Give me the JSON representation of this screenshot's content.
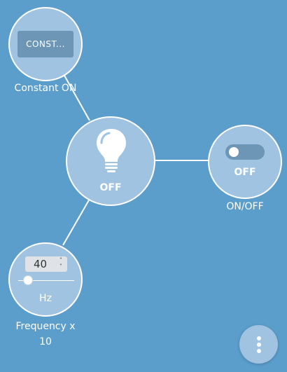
{
  "nodes": {
    "constant": {
      "button_label": "CONST...",
      "label": "Constant ON"
    },
    "bulb": {
      "state": "OFF",
      "icon": "lightbulb-icon"
    },
    "switch": {
      "state": "OFF",
      "toggle_on": false,
      "label": "ON/OFF"
    },
    "frequency": {
      "value": "40",
      "slider_value": 40,
      "unit": "Hz",
      "label_line1": "Frequency x",
      "label_line2": "10"
    }
  },
  "menu": {
    "icon": "more-vertical-icon"
  },
  "colors": {
    "background": "#5b9dcb",
    "node_fill": "#9fc3e1",
    "control_fill": "#6d95b6"
  }
}
